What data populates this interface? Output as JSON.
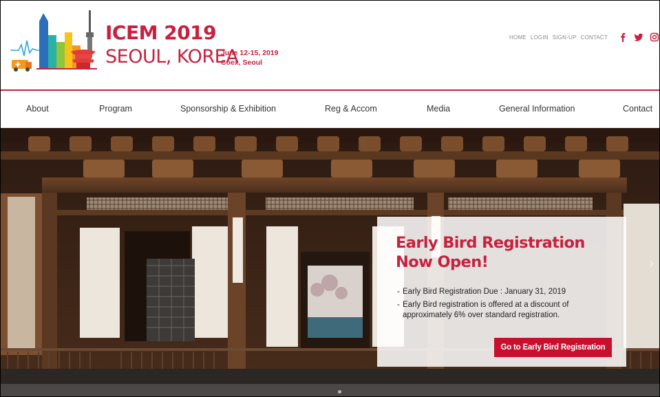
{
  "header": {
    "title_main": "ICEM 2019",
    "title_sub": "SEOUL, KOREA",
    "date": "June 12-15, 2019",
    "venue": "Coex, Seoul"
  },
  "topnav": {
    "items": [
      "HOME",
      "LOGIN",
      "SIGN-UP",
      "CONTACT"
    ],
    "social": [
      "facebook-icon",
      "twitter-icon",
      "instagram-icon"
    ]
  },
  "mainnav": {
    "items": [
      "About",
      "Program",
      "Sponsorship & Exhibition",
      "Reg & Accom",
      "Media",
      "General Information",
      "Contact"
    ]
  },
  "promo": {
    "heading_line1": "Early Bird Registration",
    "heading_line2": "Now Open!",
    "bullets": [
      "Early Bird Registration Due : January 31, 2019",
      "Early Bird registration is offered at a discount of approximately 6% over standard registration."
    ],
    "button_label": "Go to Early Bird Registration"
  },
  "colors": {
    "brand": "#c8203e",
    "button": "#c8102e"
  }
}
